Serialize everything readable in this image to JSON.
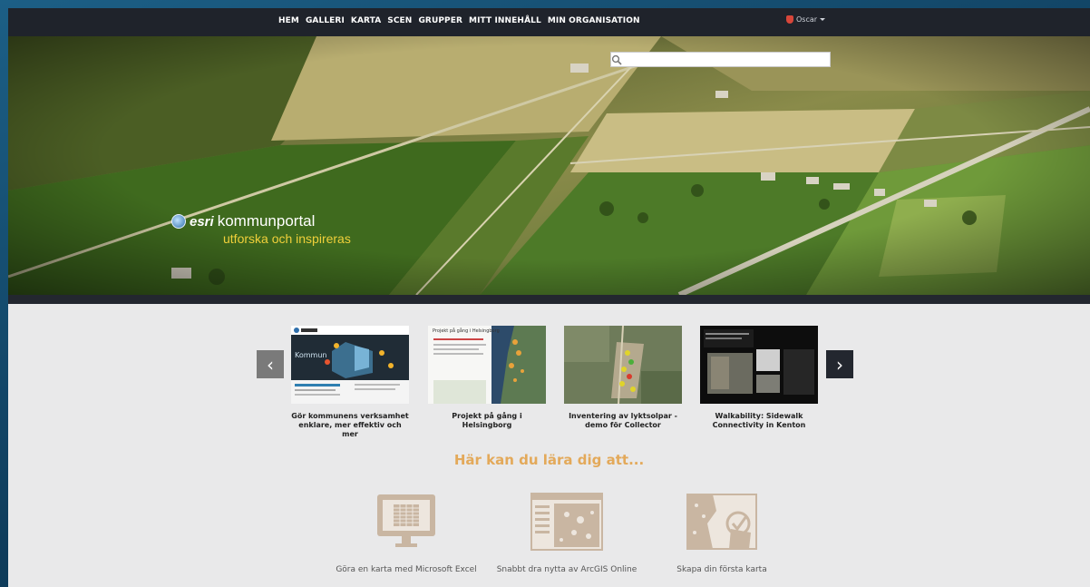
{
  "nav": {
    "items": [
      "HEM",
      "GALLERI",
      "KARTA",
      "SCEN",
      "GRUPPER",
      "MITT INNEHÅLL",
      "MIN ORGANISATION"
    ],
    "user": "Oscar"
  },
  "search": {
    "placeholder": "",
    "value": ""
  },
  "hero": {
    "brand_logo": "esri",
    "brand_name": "kommunportal",
    "tagline": "utforska och inspireras"
  },
  "carousel": {
    "prev_icon": "chevron-left-icon",
    "next_icon": "chevron-right-icon",
    "cards": [
      {
        "title": "Gör kommunens verksamhet enklare, mer effektiv och mer",
        "thumb_text": "Kommun"
      },
      {
        "title": "Projekt på gång i Helsingborg",
        "thumb_text": "Projekt på gång i Helsingborg"
      },
      {
        "title": "Inventering av lyktsolpar - demo för Collector",
        "thumb_text": ""
      },
      {
        "title": "Walkability: Sidewalk Connectivity in Kenton",
        "thumb_text": ""
      }
    ]
  },
  "learn": {
    "heading": "Här kan du lära dig att...",
    "items": [
      {
        "label": "Göra en karta med Microsoft Excel",
        "icon": "monitor-spreadsheet-icon"
      },
      {
        "label": "Snabbt dra nytta av ArcGIS Online",
        "icon": "web-map-app-icon"
      },
      {
        "label": "Skapa din första karta",
        "icon": "map-check-icon"
      }
    ]
  },
  "colors": {
    "nav_bg": "#1f232b",
    "page_bg": "#e9e9ea",
    "accent_yellow": "#f0d03a",
    "learn_heading": "#e3a95a",
    "icon_tan": "#c9b6a2"
  }
}
